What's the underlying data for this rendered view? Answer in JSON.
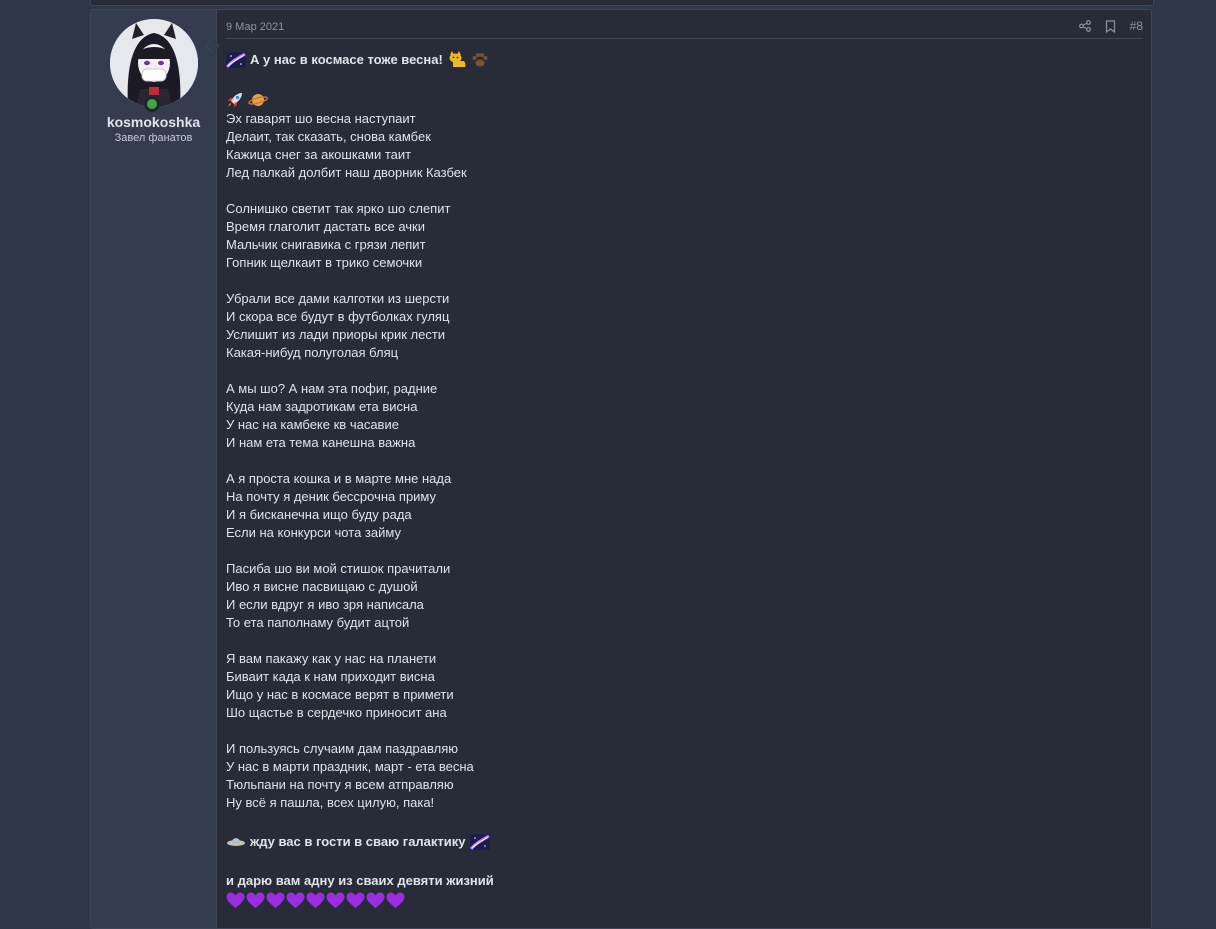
{
  "post": {
    "date": "9 Мар 2021",
    "number": "#8",
    "author": {
      "name": "kosmokoshka",
      "title": "Завел фанатов",
      "status": "online"
    },
    "icons": {
      "share": "share-icon",
      "bookmark": "bookmark-icon"
    },
    "title_line": "А у нас в космасе тоже весна!",
    "poem_stanzas": [
      [
        "Эх гаварят шо весна наступаит",
        "Делаит, так сказать, снова камбек",
        "Кажица снег за акошками таит",
        "Лед палкай долбит наш дворник Казбек"
      ],
      [
        "Солнишко светит так ярко шо слепит",
        "Время глаголит дастать все ачки",
        "Мальчик снигавика с грязи лепит",
        "Гопник щелкаит в трико семочки"
      ],
      [
        "Убрали все дами калготки из шерсти",
        "И скора все будут в футболках гуляц",
        "Услишит из лади приоры крик лести",
        "Какая-нибуд полуголая бляц"
      ],
      [
        "А мы шо? А нам эта пофиг, радние",
        "Куда нам задротикам ета висна",
        "У нас на камбеке кв часавие",
        "И нам ета тема канешна важна"
      ],
      [
        "А я проста кошка и в марте мне нада",
        "На почту я деник бессрочна приму",
        "И я бисканечна ищо буду рада",
        "Если на конкурси чота займу"
      ],
      [
        "Пасиба шо ви мой стишок прачитали",
        "Иво я висне пасвищаю с душой",
        "И если вдруг я иво зря написала",
        "То ета паполнаму будит ацтой"
      ],
      [
        "Я вам пакажу как у нас на планети",
        "Биваит када к нам приходит висна",
        "Ищо у нас в космасе верят в примети",
        "Шо щастье в сердечко приносит ана"
      ],
      [
        "И пользуясь случаим дам паздравляю",
        "У нас в марти праздник, март - ета весна",
        "Тюльпани на почту я всем атправляю",
        "Ну всё я пашла, всех цилую, пака!"
      ]
    ],
    "invite_line": "жду вас в гости в сваю галактику",
    "gift_line": "и дарю вам адну из сваих девяти жизний",
    "hearts_count": 9,
    "colors": {
      "page_bg": "#2f3849",
      "post_bg": "#272c38",
      "user_cell_bg": "#343c4d",
      "text": "#dfe3ea",
      "muted": "#8c93a1",
      "online": "#3fa53f",
      "heart": "#9b2de0"
    }
  }
}
